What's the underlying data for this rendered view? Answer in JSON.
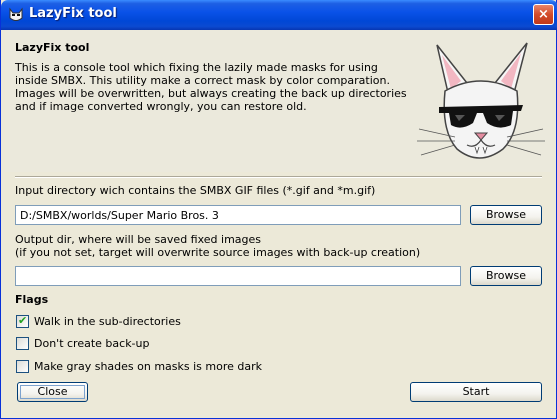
{
  "window": {
    "title": "LazyFix tool",
    "close_glyph": "×"
  },
  "header": {
    "title": "LazyFix tool",
    "description": "This is a console tool which fixing the lazily made masks for using inside SMBX. This utility make a correct mask by color comparation. Images will be overwritten, but always creating the back up directories and if image converted wrongly, you can restore old."
  },
  "input_dir": {
    "label": "Input directory wich contains the SMBX GIF files (*.gif and *m.gif)",
    "value": "D:/SMBX/worlds/Super Mario Bros. 3",
    "browse": "Browse"
  },
  "output_dir": {
    "label_line1": "Output dir, where will be saved fixed images",
    "label_line2": "(if you not set, target will overwrite source images with back-up creation)",
    "value": "",
    "browse": "Browse"
  },
  "flags": {
    "title": "Flags",
    "items": [
      {
        "label": "Walk in the sub-directories",
        "checked": true
      },
      {
        "label": "Don't create back-up",
        "checked": false
      },
      {
        "label": "Make gray shades on masks is more dark",
        "checked": false
      }
    ],
    "check_glyph": "✔"
  },
  "buttons": {
    "close": "Close",
    "start": "Start"
  },
  "icons": {
    "title_icon": "cat-icon",
    "illustration": "cat-with-sunglasses-icon"
  }
}
